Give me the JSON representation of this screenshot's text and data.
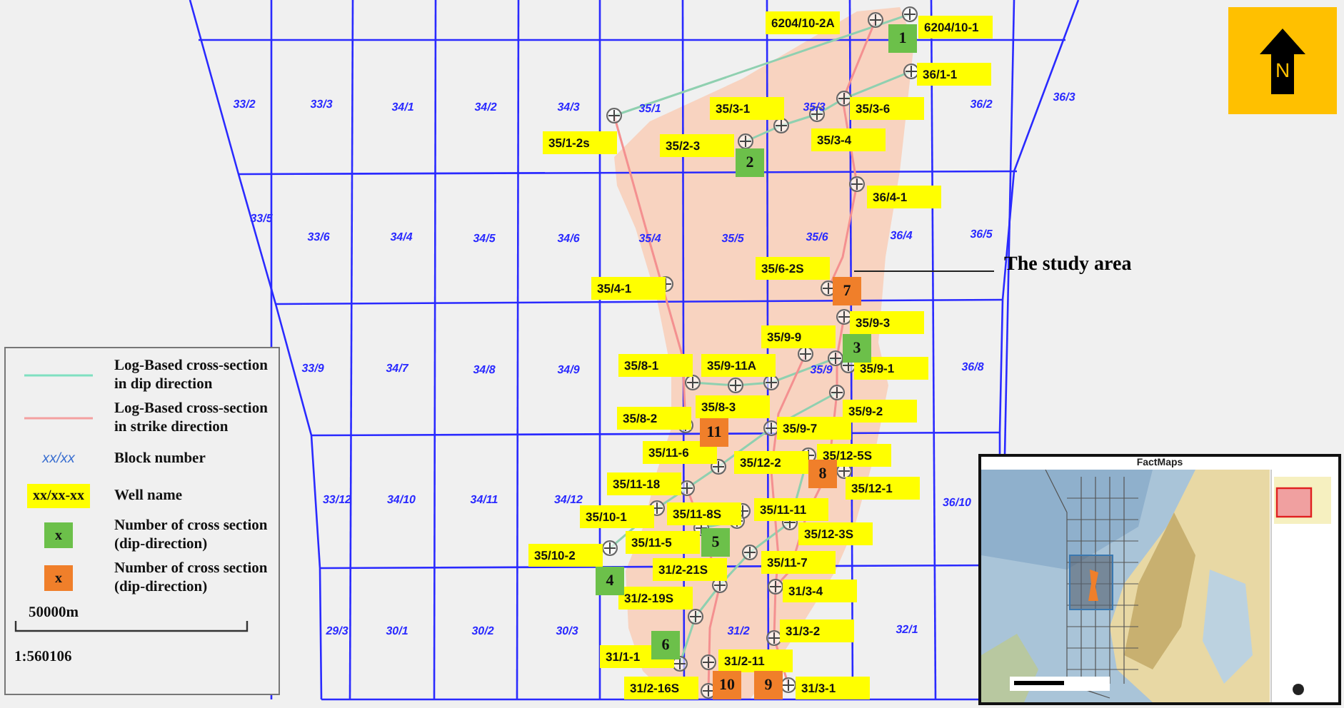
{
  "north_arrow": {
    "label": "N"
  },
  "blocks": [
    {
      "label": "33/2"
    },
    {
      "label": "33/3"
    },
    {
      "label": "34/1"
    },
    {
      "label": "34/2"
    },
    {
      "label": "34/3"
    },
    {
      "label": "35/1"
    },
    {
      "label": "35/3"
    },
    {
      "label": "36/2"
    },
    {
      "label": "36/3"
    },
    {
      "label": "33/5"
    },
    {
      "label": "33/6"
    },
    {
      "label": "34/4"
    },
    {
      "label": "34/5"
    },
    {
      "label": "34/6"
    },
    {
      "label": "35/4"
    },
    {
      "label": "35/5"
    },
    {
      "label": "35/6"
    },
    {
      "label": "36/4"
    },
    {
      "label": "36/5"
    },
    {
      "label": "33/9"
    },
    {
      "label": "34/7"
    },
    {
      "label": "34/8"
    },
    {
      "label": "34/9"
    },
    {
      "label": "35/9"
    },
    {
      "label": "36/8"
    },
    {
      "label": "33/12"
    },
    {
      "label": "34/10"
    },
    {
      "label": "34/11"
    },
    {
      "label": "34/12"
    },
    {
      "label": "36/10"
    },
    {
      "label": "29/3"
    },
    {
      "label": "30/1"
    },
    {
      "label": "30/2"
    },
    {
      "label": "30/3"
    },
    {
      "label": "31/2"
    },
    {
      "label": "32/1"
    }
  ],
  "wells": [
    {
      "name": "6204/10-2A"
    },
    {
      "name": "6204/10-1"
    },
    {
      "name": "36/1-1"
    },
    {
      "name": "35/3-1"
    },
    {
      "name": "35/3-6"
    },
    {
      "name": "35/1-2s"
    },
    {
      "name": "35/2-3"
    },
    {
      "name": "35/3-4"
    },
    {
      "name": "36/4-1"
    },
    {
      "name": "35/6-2S"
    },
    {
      "name": "35/4-1"
    },
    {
      "name": "35/9-3"
    },
    {
      "name": "35/9-9"
    },
    {
      "name": "35/8-1"
    },
    {
      "name": "35/9-11A"
    },
    {
      "name": "35/9-1"
    },
    {
      "name": "35/8-3"
    },
    {
      "name": "35/8-2"
    },
    {
      "name": "35/9-2"
    },
    {
      "name": "35/9-7"
    },
    {
      "name": "35/11-6"
    },
    {
      "name": "35/12-2"
    },
    {
      "name": "35/12-5S"
    },
    {
      "name": "35/12-1"
    },
    {
      "name": "35/11-18"
    },
    {
      "name": "35/10-1"
    },
    {
      "name": "35/11-8S"
    },
    {
      "name": "35/11-11"
    },
    {
      "name": "35/12-3S"
    },
    {
      "name": "35/11-5"
    },
    {
      "name": "35/10-2"
    },
    {
      "name": "35/11-7"
    },
    {
      "name": "31/2-21S"
    },
    {
      "name": "31/3-4"
    },
    {
      "name": "31/2-19S"
    },
    {
      "name": "31/3-2"
    },
    {
      "name": "31/1-1"
    },
    {
      "name": "31/2-11"
    },
    {
      "name": "31/2-16S"
    },
    {
      "name": "31/3-1"
    }
  ],
  "cross_sections": [
    {
      "number": "1",
      "kind": "dip"
    },
    {
      "number": "2",
      "kind": "dip"
    },
    {
      "number": "7",
      "kind": "strike"
    },
    {
      "number": "3",
      "kind": "dip"
    },
    {
      "number": "11",
      "kind": "strike"
    },
    {
      "number": "8",
      "kind": "strike"
    },
    {
      "number": "5",
      "kind": "dip"
    },
    {
      "number": "4",
      "kind": "dip"
    },
    {
      "number": "6",
      "kind": "dip"
    },
    {
      "number": "10",
      "kind": "strike"
    },
    {
      "number": "9",
      "kind": "strike"
    }
  ],
  "callout": {
    "text": "The study area"
  },
  "legend": {
    "items": [
      {
        "kind": "dip-line",
        "text": "Log-Based cross-section in dip direction"
      },
      {
        "kind": "strike-line",
        "text": "Log-Based cross-section in strike direction"
      },
      {
        "kind": "block",
        "symbol": "xx/xx",
        "text": "Block number"
      },
      {
        "kind": "well",
        "symbol": "xx/xx-xx",
        "text": "Well name"
      },
      {
        "kind": "dip-number",
        "symbol": "x",
        "text": "Number of cross section (dip-direction)"
      },
      {
        "kind": "strike-number",
        "symbol": "x",
        "text": "Number of cross section (dip-direction)"
      }
    ],
    "scale_bar": "50000m",
    "ratio": "1:560106"
  },
  "inset": {
    "title": "FactMaps"
  }
}
